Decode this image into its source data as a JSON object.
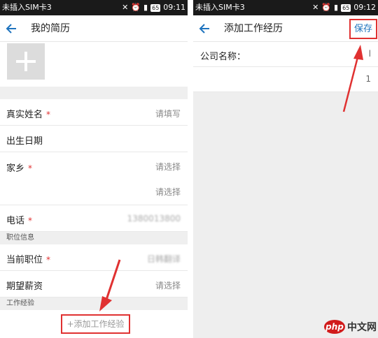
{
  "left": {
    "statusbar": {
      "carrier": "未插入SIM卡3",
      "battery": "65",
      "time": "09:11"
    },
    "appbar": {
      "title": "我的简历"
    },
    "fields": [
      {
        "label": "真实姓名",
        "required": "*",
        "value": "请填写"
      },
      {
        "label": "出生日期",
        "required": "",
        "value": ""
      },
      {
        "label": "家乡",
        "required": "*",
        "value": "请选择"
      },
      {
        "label": "",
        "required": "",
        "value": "请选择"
      },
      {
        "label": "电话",
        "required": "*",
        "value": "1380013800"
      }
    ],
    "section_job": "职位信息",
    "job_fields": [
      {
        "label": "当前职位",
        "required": "*",
        "value": "日韩翻译"
      },
      {
        "label": "期望薪资",
        "required": "",
        "value": "请选择"
      }
    ],
    "section_exp": "工作经验",
    "add_experience": "+添加工作经验"
  },
  "right": {
    "statusbar": {
      "carrier": "未插入SIM卡3",
      "battery": "65",
      "time": "09:12"
    },
    "appbar": {
      "title": "添加工作经历",
      "save": "保存"
    },
    "company_label": "公司名称：",
    "edge_marks": [
      "l",
      "1"
    ]
  },
  "watermark": {
    "logo": "php",
    "text": "中文网"
  },
  "colors": {
    "accent": "#1e73be",
    "annotation": "#e03131",
    "required": "#e03131"
  }
}
